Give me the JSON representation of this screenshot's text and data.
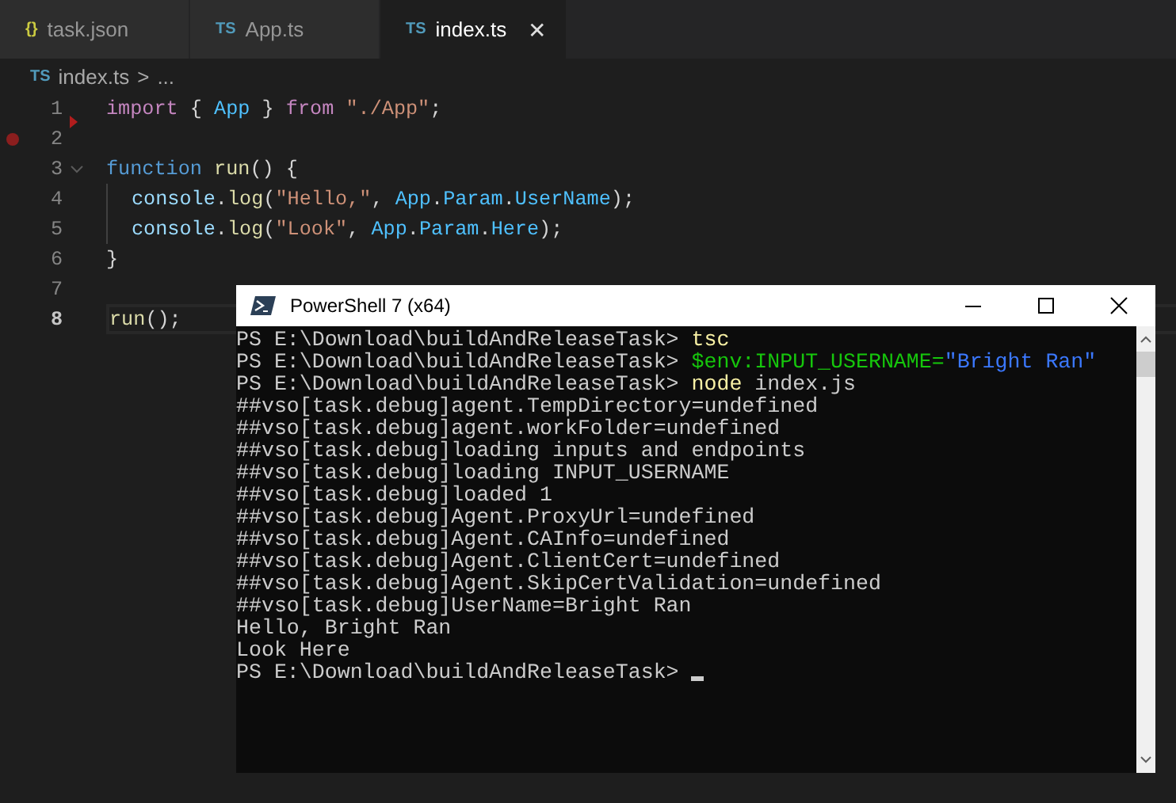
{
  "tabs": [
    {
      "icon": "{}",
      "color": "#cbcb41",
      "label": "task.json",
      "selected": false
    },
    {
      "icon": "TS",
      "color": "#519aba",
      "label": "App.ts",
      "selected": false
    },
    {
      "icon": "TS",
      "color": "#519aba",
      "label": "index.ts",
      "selected": true,
      "close": "✕"
    }
  ],
  "breadcrumb": {
    "icon": "TS",
    "file": "index.ts",
    "separator": ">",
    "rest": "..."
  },
  "editor": {
    "lines": [
      {
        "number": "1",
        "current": false,
        "breakpoint": false,
        "marker": true,
        "foldable": false,
        "indented": false,
        "tokens": [
          {
            "text": "import",
            "kind": "keyword"
          },
          {
            "text": " { ",
            "kind": "punct"
          },
          {
            "text": "App",
            "kind": "ident"
          },
          {
            "text": " } ",
            "kind": "punct"
          },
          {
            "text": "from",
            "kind": "keyword"
          },
          {
            "text": " \"./App\"",
            "kind": "string"
          },
          {
            "text": ";",
            "kind": "punct"
          }
        ]
      },
      {
        "number": "2",
        "current": false,
        "breakpoint": true,
        "marker": false,
        "foldable": false,
        "indented": false
      },
      {
        "number": "3",
        "current": false,
        "breakpoint": false,
        "marker": false,
        "foldable": true,
        "indented": false,
        "tokens": [
          {
            "text": "function",
            "kind": "storage"
          },
          {
            "text": " run",
            "kind": "func"
          },
          {
            "text": "() {",
            "kind": "punct"
          }
        ]
      },
      {
        "number": "4",
        "current": false,
        "breakpoint": false,
        "marker": false,
        "foldable": false,
        "indented": true,
        "tokens": [
          {
            "text": "console",
            "kind": "var"
          },
          {
            "text": ".",
            "kind": "punct"
          },
          {
            "text": "log",
            "kind": "func"
          },
          {
            "text": "(",
            "kind": "punct"
          },
          {
            "text": "\"Hello,\"",
            "kind": "string"
          },
          {
            "text": ", ",
            "kind": "punct"
          },
          {
            "text": "App",
            "kind": "ident"
          },
          {
            "text": ".",
            "kind": "punct"
          },
          {
            "text": "Param",
            "kind": "ident"
          },
          {
            "text": ".",
            "kind": "punct"
          },
          {
            "text": "UserName",
            "kind": "ident"
          },
          {
            "text": ");",
            "kind": "punct"
          }
        ]
      },
      {
        "number": "5",
        "current": false,
        "breakpoint": false,
        "marker": false,
        "foldable": false,
        "indented": true,
        "tokens": [
          {
            "text": "console",
            "kind": "var"
          },
          {
            "text": ".",
            "kind": "punct"
          },
          {
            "text": "log",
            "kind": "func"
          },
          {
            "text": "(",
            "kind": "punct"
          },
          {
            "text": "\"Look\"",
            "kind": "string"
          },
          {
            "text": ", ",
            "kind": "punct"
          },
          {
            "text": "App",
            "kind": "ident"
          },
          {
            "text": ".",
            "kind": "punct"
          },
          {
            "text": "Param",
            "kind": "ident"
          },
          {
            "text": ".",
            "kind": "punct"
          },
          {
            "text": "Here",
            "kind": "ident"
          },
          {
            "text": ");",
            "kind": "punct"
          }
        ]
      },
      {
        "number": "6",
        "current": false,
        "breakpoint": false,
        "marker": false,
        "foldable": false,
        "indented": false,
        "tokens": [
          {
            "text": "}",
            "kind": "punct"
          }
        ]
      },
      {
        "number": "7",
        "current": false,
        "breakpoint": false,
        "marker": false,
        "foldable": false,
        "indented": false
      },
      {
        "number": "8",
        "current": true,
        "breakpoint": false,
        "marker": false,
        "foldable": false,
        "indented": false,
        "tokens": [
          {
            "text": "run",
            "kind": "func"
          },
          {
            "text": "();",
            "kind": "punct"
          }
        ]
      }
    ]
  },
  "terminal": {
    "title": "PowerShell 7 (x64)",
    "lines": [
      {
        "cursor": false,
        "tokens": [
          {
            "text": "PS E:\\Download\\buildAndReleaseTask> ",
            "kind": "plain"
          },
          {
            "text": "tsc",
            "kind": "command"
          }
        ]
      },
      {
        "cursor": false,
        "tokens": [
          {
            "text": "PS E:\\Download\\buildAndReleaseTask> ",
            "kind": "plain"
          },
          {
            "text": "$env:INPUT_USERNAME=",
            "kind": "variable"
          },
          {
            "text": "\"Bright Ran\"",
            "kind": "string"
          }
        ]
      },
      {
        "cursor": false,
        "tokens": [
          {
            "text": "PS E:\\Download\\buildAndReleaseTask> ",
            "kind": "plain"
          },
          {
            "text": "node",
            "kind": "command"
          },
          {
            "text": " index.js",
            "kind": "plain"
          }
        ]
      },
      {
        "cursor": false,
        "tokens": [
          {
            "text": "##vso[task.debug]agent.TempDirectory=undefined",
            "kind": "plain"
          }
        ]
      },
      {
        "cursor": false,
        "tokens": [
          {
            "text": "##vso[task.debug]agent.workFolder=undefined",
            "kind": "plain"
          }
        ]
      },
      {
        "cursor": false,
        "tokens": [
          {
            "text": "##vso[task.debug]loading inputs and endpoints",
            "kind": "plain"
          }
        ]
      },
      {
        "cursor": false,
        "tokens": [
          {
            "text": "##vso[task.debug]loading INPUT_USERNAME",
            "kind": "plain"
          }
        ]
      },
      {
        "cursor": false,
        "tokens": [
          {
            "text": "##vso[task.debug]loaded 1",
            "kind": "plain"
          }
        ]
      },
      {
        "cursor": false,
        "tokens": [
          {
            "text": "##vso[task.debug]Agent.ProxyUrl=undefined",
            "kind": "plain"
          }
        ]
      },
      {
        "cursor": false,
        "tokens": [
          {
            "text": "##vso[task.debug]Agent.CAInfo=undefined",
            "kind": "plain"
          }
        ]
      },
      {
        "cursor": false,
        "tokens": [
          {
            "text": "##vso[task.debug]Agent.ClientCert=undefined",
            "kind": "plain"
          }
        ]
      },
      {
        "cursor": false,
        "tokens": [
          {
            "text": "##vso[task.debug]Agent.SkipCertValidation=undefined",
            "kind": "plain"
          }
        ]
      },
      {
        "cursor": false,
        "tokens": [
          {
            "text": "##vso[task.debug]UserName=Bright Ran",
            "kind": "plain"
          }
        ]
      },
      {
        "cursor": false,
        "tokens": [
          {
            "text": "Hello, Bright Ran",
            "kind": "plain"
          }
        ]
      },
      {
        "cursor": false,
        "tokens": [
          {
            "text": "Look Here",
            "kind": "plain"
          }
        ]
      },
      {
        "cursor": true,
        "tokens": [
          {
            "text": "PS E:\\Download\\buildAndReleaseTask> ",
            "kind": "plain"
          }
        ]
      }
    ]
  }
}
